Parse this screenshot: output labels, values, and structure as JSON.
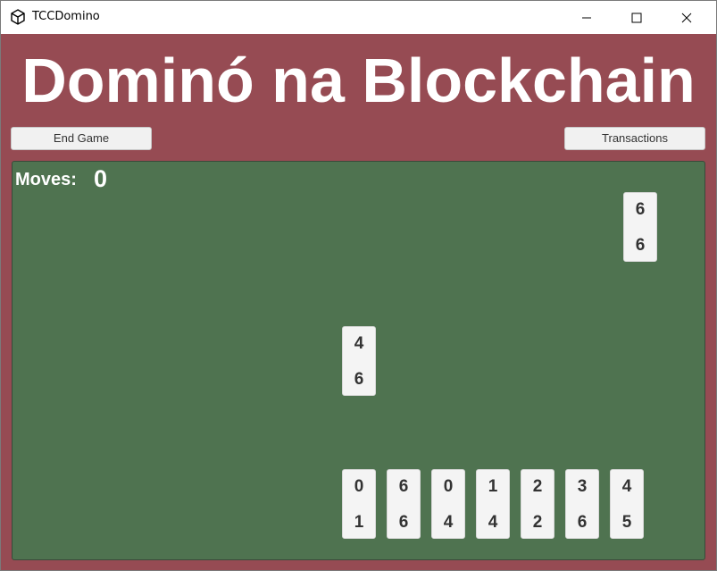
{
  "window": {
    "title": "TCCDomino"
  },
  "app": {
    "title": "Dominó na Blockchain"
  },
  "buttons": {
    "end_game": "End Game",
    "transactions": "Transactions"
  },
  "moves": {
    "label": "Moves:",
    "value": "0"
  },
  "opponent_tile": {
    "top": "6",
    "bottom": "6"
  },
  "board_tile": {
    "top": "4",
    "bottom": "6"
  },
  "hand_tiles": [
    {
      "top": "0",
      "bottom": "1"
    },
    {
      "top": "6",
      "bottom": "6"
    },
    {
      "top": "0",
      "bottom": "4"
    },
    {
      "top": "1",
      "bottom": "4"
    },
    {
      "top": "2",
      "bottom": "2"
    },
    {
      "top": "3",
      "bottom": "6"
    },
    {
      "top": "4",
      "bottom": "5"
    }
  ],
  "colors": {
    "background": "#964b53",
    "board": "#4f7350",
    "tile": "#f4f4f4",
    "text": "#ffffff"
  }
}
